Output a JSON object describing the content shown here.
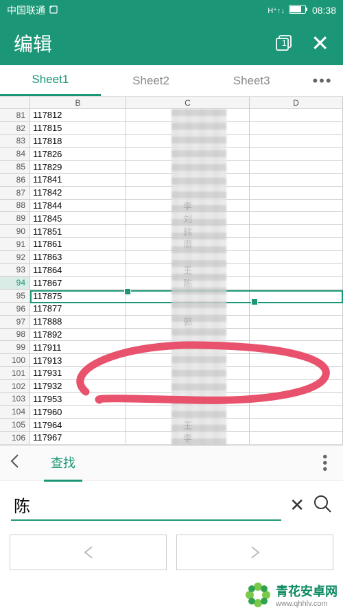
{
  "status": {
    "carrier": "中国联通",
    "time": "08:38"
  },
  "header": {
    "title": "编辑",
    "tab_count": "1"
  },
  "tabs": {
    "t1": "Sheet1",
    "t2": "Sheet2",
    "t3": "Sheet3",
    "more": "•••"
  },
  "columns": {
    "B": "B",
    "C": "C",
    "D": "D"
  },
  "rows": [
    {
      "n": "81",
      "b": "117812",
      "c": ""
    },
    {
      "n": "82",
      "b": "117815",
      "c": ""
    },
    {
      "n": "83",
      "b": "117818",
      "c": ""
    },
    {
      "n": "84",
      "b": "117826",
      "c": ""
    },
    {
      "n": "85",
      "b": "117829",
      "c": ""
    },
    {
      "n": "86",
      "b": "117841",
      "c": ""
    },
    {
      "n": "87",
      "b": "117842",
      "c": ""
    },
    {
      "n": "88",
      "b": "117844",
      "c": "李"
    },
    {
      "n": "89",
      "b": "117845",
      "c": "刘"
    },
    {
      "n": "90",
      "b": "117851",
      "c": "韩"
    },
    {
      "n": "91",
      "b": "117861",
      "c": "周"
    },
    {
      "n": "92",
      "b": "117863",
      "c": ""
    },
    {
      "n": "93",
      "b": "117864",
      "c": "王"
    },
    {
      "n": "94",
      "b": "117867",
      "c": "陈",
      "sel": true
    },
    {
      "n": "95",
      "b": "117875",
      "c": ""
    },
    {
      "n": "96",
      "b": "117877",
      "c": ""
    },
    {
      "n": "97",
      "b": "117888",
      "c": "郭"
    },
    {
      "n": "98",
      "b": "117892",
      "c": ""
    },
    {
      "n": "99",
      "b": "117911",
      "c": ""
    },
    {
      "n": "100",
      "b": "117913",
      "c": ""
    },
    {
      "n": "101",
      "b": "117931",
      "c": ""
    },
    {
      "n": "102",
      "b": "117932",
      "c": ""
    },
    {
      "n": "103",
      "b": "117953",
      "c": ""
    },
    {
      "n": "104",
      "b": "117960",
      "c": ""
    },
    {
      "n": "105",
      "b": "117964",
      "c": "王"
    },
    {
      "n": "106",
      "b": "117967",
      "c": "李"
    }
  ],
  "search": {
    "tab_label": "查找",
    "value": "陈",
    "prev": "<",
    "next": ">"
  },
  "watermark": {
    "brand": "青花安卓网",
    "url": "www.qhhlv.com"
  },
  "accent": "#1b9676"
}
